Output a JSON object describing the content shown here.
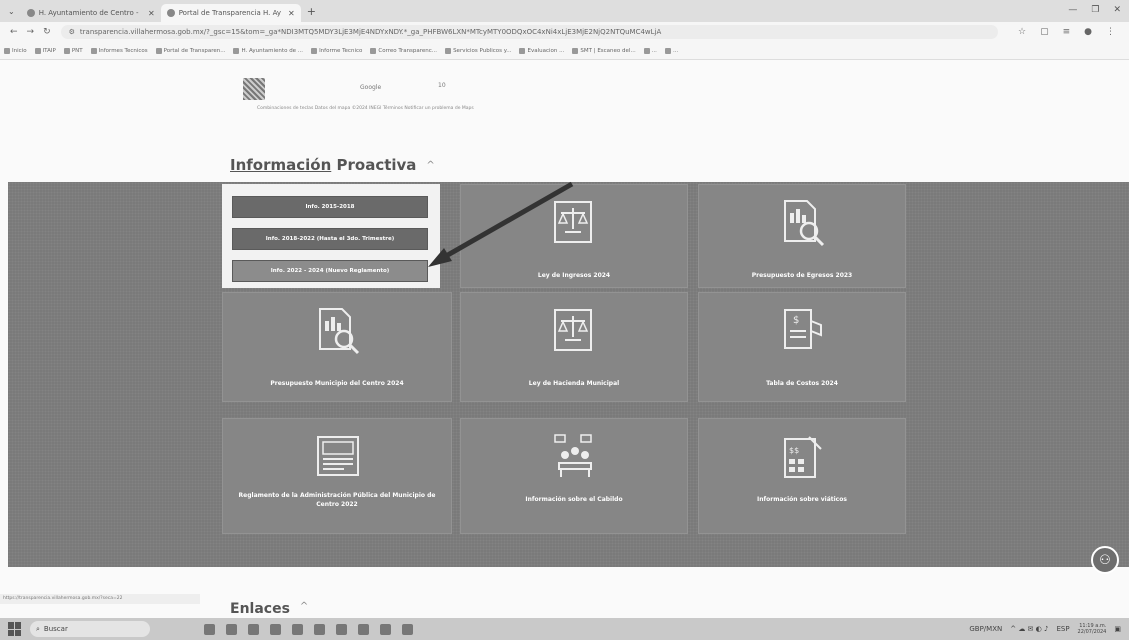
{
  "browser": {
    "tabs": [
      {
        "title": "H. Ayuntamiento de Centro -",
        "active": false
      },
      {
        "title": "Portal de Transparencia H. Ay",
        "active": true
      }
    ],
    "url": "transparencia.villahermosa.gob.mx/?_gsc=15&tom=_ga*NDI3MTQ5MDY3LjE3MjE4NDYxNDY.*_ga_PHFBW6LXN*MTcyMTY0ODQxOC4xNi4xLjE3MjE2NjQ2NTQuMC4wLjA"
  },
  "bookmarks": [
    "Inicio",
    "ITAIP",
    "PNT",
    "Informes Tecnicos",
    "Portal de Transparen...",
    "H. Ayuntamiento de ...",
    "Informe Tecnico",
    "Correo Transparenc...",
    "Servicios Publicos y...",
    "Evaluacion ...",
    "SMT | Escaneo del...",
    "...",
    "..."
  ],
  "recaptcha": {
    "provider": "Google",
    "number": "10",
    "footer": "Combinaciones de teclas   Datos del mapa ©2024 INEGI   Términos   Notificar un problema de Maps"
  },
  "section": {
    "title_underlined": "Información",
    "title_rest": "Proactiva",
    "chevron": "^"
  },
  "menu": {
    "items": [
      {
        "label": "Info. 2015-2018",
        "selected": false
      },
      {
        "label": "Info. 2018-2022 (Hasta el 3do. Trimestre)",
        "selected": false
      },
      {
        "label": "Info. 2022 - 2024 (Nuevo Reglamento)",
        "selected": true
      }
    ]
  },
  "cards": [
    {
      "label": "Ley de Ingresos 2024",
      "icon": "law-book-icon"
    },
    {
      "label": "Presupuesto de Egresos 2023",
      "icon": "budget-report-icon"
    },
    {
      "label": "Presupuesto Municipio del Centro 2024",
      "icon": "budget-report-icon"
    },
    {
      "label": "Ley de Hacienda Municipal",
      "icon": "law-book-icon"
    },
    {
      "label": "Tabla de Costos 2024",
      "icon": "cost-table-icon"
    },
    {
      "label": "Reglamento de la Administración Pública del Municipio de Centro 2022",
      "icon": "regulation-icon"
    },
    {
      "label": "Información sobre el Cabildo",
      "icon": "council-meeting-icon"
    },
    {
      "label": "Información sobre viáticos",
      "icon": "travel-expenses-icon"
    }
  ],
  "status_url": "https://transparencia.villahermosa.gob.mx/?seca=22",
  "enlaces": {
    "title": "Enlaces",
    "chevron": "^"
  },
  "taskbar": {
    "search_placeholder": "Buscar",
    "currency": "GBP/MXN",
    "lang": "ESP",
    "time": "11:19 a.m.",
    "date": "22/07/2024"
  }
}
